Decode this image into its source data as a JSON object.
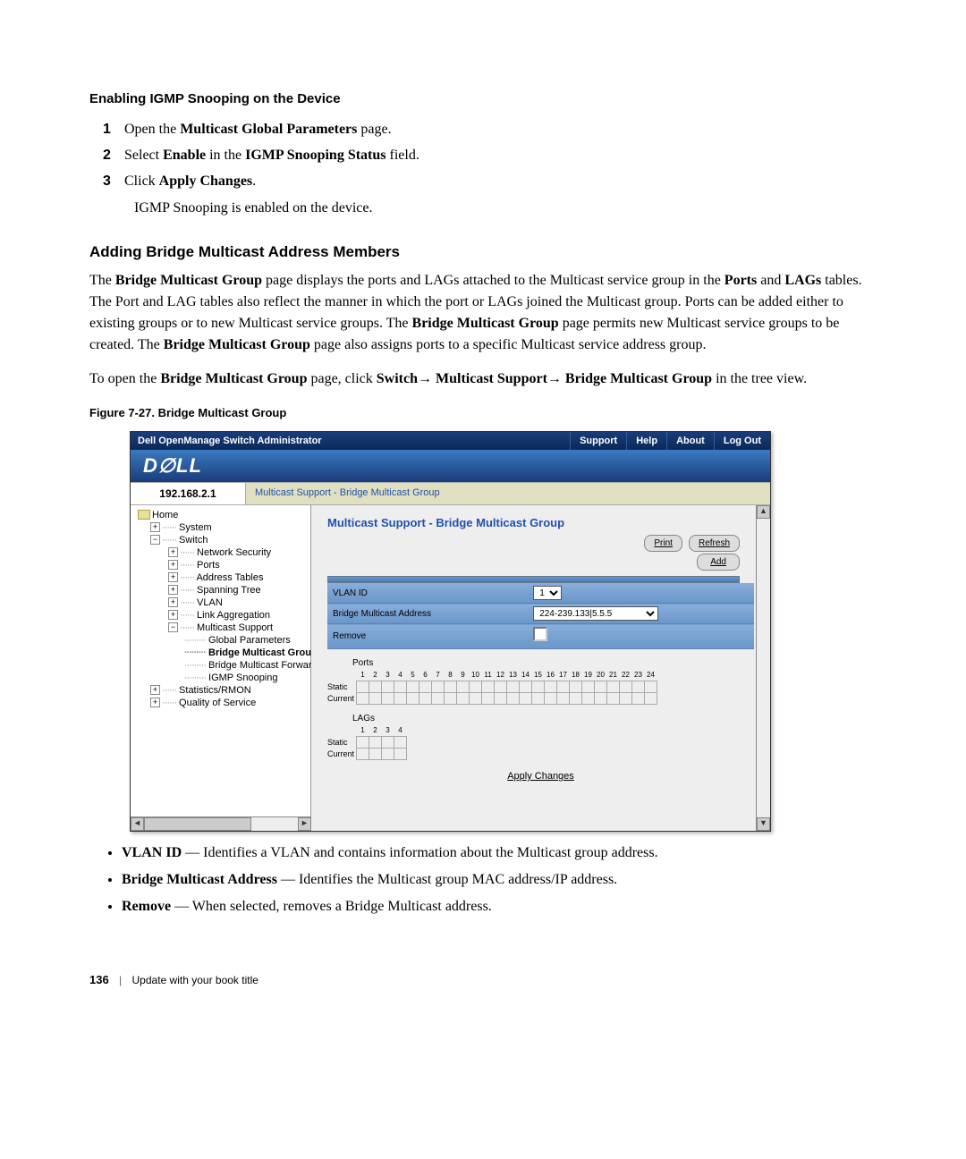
{
  "sect1_heading": "Enabling IGMP Snooping on the Device",
  "steps": {
    "s1_num": "1",
    "s1_a": "Open the ",
    "s1_b": "Multicast Global Parameters",
    "s1_c": " page.",
    "s2_num": "2",
    "s2_a": "Select ",
    "s2_b": "Enable",
    "s2_c": " in the ",
    "s2_d": "IGMP Snooping Status",
    "s2_e": " field.",
    "s3_num": "3",
    "s3_a": "Click ",
    "s3_b": "Apply Changes",
    "s3_c": ".",
    "s3_result": "IGMP Snooping is enabled on the device."
  },
  "sub_heading": "Adding Bridge Multicast Address Members",
  "para1": {
    "t1": "The ",
    "t2": "Bridge Multicast Group",
    "t3": " page displays the ports and LAGs attached to the Multicast service group in the ",
    "t4": "Ports",
    "t5": " and ",
    "t6": "LAGs",
    "t7": " tables. The Port and LAG tables also reflect the manner in which the port or LAGs joined the Multicast group. Ports can be added either to existing groups or to new Multicast service groups. The ",
    "t8": "Bridge Multicast Group",
    "t9": " page permits new Multicast service groups to be created. The ",
    "t10": "Bridge Multicast Group",
    "t11": " page also assigns ports to a specific Multicast service address group."
  },
  "para2": {
    "t1": "To open the ",
    "t2": "Bridge Multicast Group",
    "t3": " page, click ",
    "t4": "Switch",
    "t5": "→ ",
    "t6": "Multicast Support",
    "t7": "→ ",
    "t8": "Bridge Multicast Group",
    "t9": " in the tree view."
  },
  "fig_caption": "Figure 7-27.    Bridge Multicast Group",
  "app": {
    "title": "Dell OpenManage Switch Administrator",
    "links": {
      "support": "Support",
      "help": "Help",
      "about": "About",
      "logout": "Log Out"
    },
    "logo": "D∅LL",
    "ip": "192.168.2.1",
    "crumb": "Multicast Support - Bridge Multicast Group",
    "tree": {
      "home": "Home",
      "system": "System",
      "switch": "Switch",
      "netsec": "Network Security",
      "ports": "Ports",
      "addrtbl": "Address Tables",
      "span": "Spanning Tree",
      "vlan": "VLAN",
      "linkagg": "Link Aggregation",
      "mcast": "Multicast Support",
      "global": "Global Parameters",
      "bmg": "Bridge Multicast Group",
      "bmfa": "Bridge Multicast Forward All",
      "igmp": "IGMP Snooping",
      "stats": "Statistics/RMON",
      "qos": "Quality of Service"
    },
    "panel_title": "Multicast Support - Bridge Multicast Group",
    "btn_print": "Print",
    "btn_refresh": "Refresh",
    "btn_add": "Add",
    "fld_vlan": "VLAN ID",
    "fld_bma": "Bridge Multicast Address",
    "fld_remove": "Remove",
    "val_vlan": "1",
    "val_bma": "224-239.133|5.5.5",
    "lbl_ports": "Ports",
    "lbl_lags": "LAGs",
    "row_static": "Static",
    "row_current": "Current",
    "port_nums": [
      "1",
      "2",
      "3",
      "4",
      "5",
      "6",
      "7",
      "8",
      "9",
      "10",
      "11",
      "12",
      "13",
      "14",
      "15",
      "16",
      "17",
      "18",
      "19",
      "20",
      "21",
      "22",
      "23",
      "24"
    ],
    "lag_nums": [
      "1",
      "2",
      "3",
      "4"
    ],
    "apply": "Apply Changes"
  },
  "bullets": {
    "b1a": "VLAN ID",
    "b1b": " — Identifies a VLAN and contains information about the Multicast group address.",
    "b2a": "Bridge Multicast Address",
    "b2b": " — Identifies the Multicast group MAC address/IP address.",
    "b3a": "Remove",
    "b3b": " — When selected, removes a Bridge Multicast address."
  },
  "footer": {
    "page": "136",
    "title": "Update with your book title"
  }
}
